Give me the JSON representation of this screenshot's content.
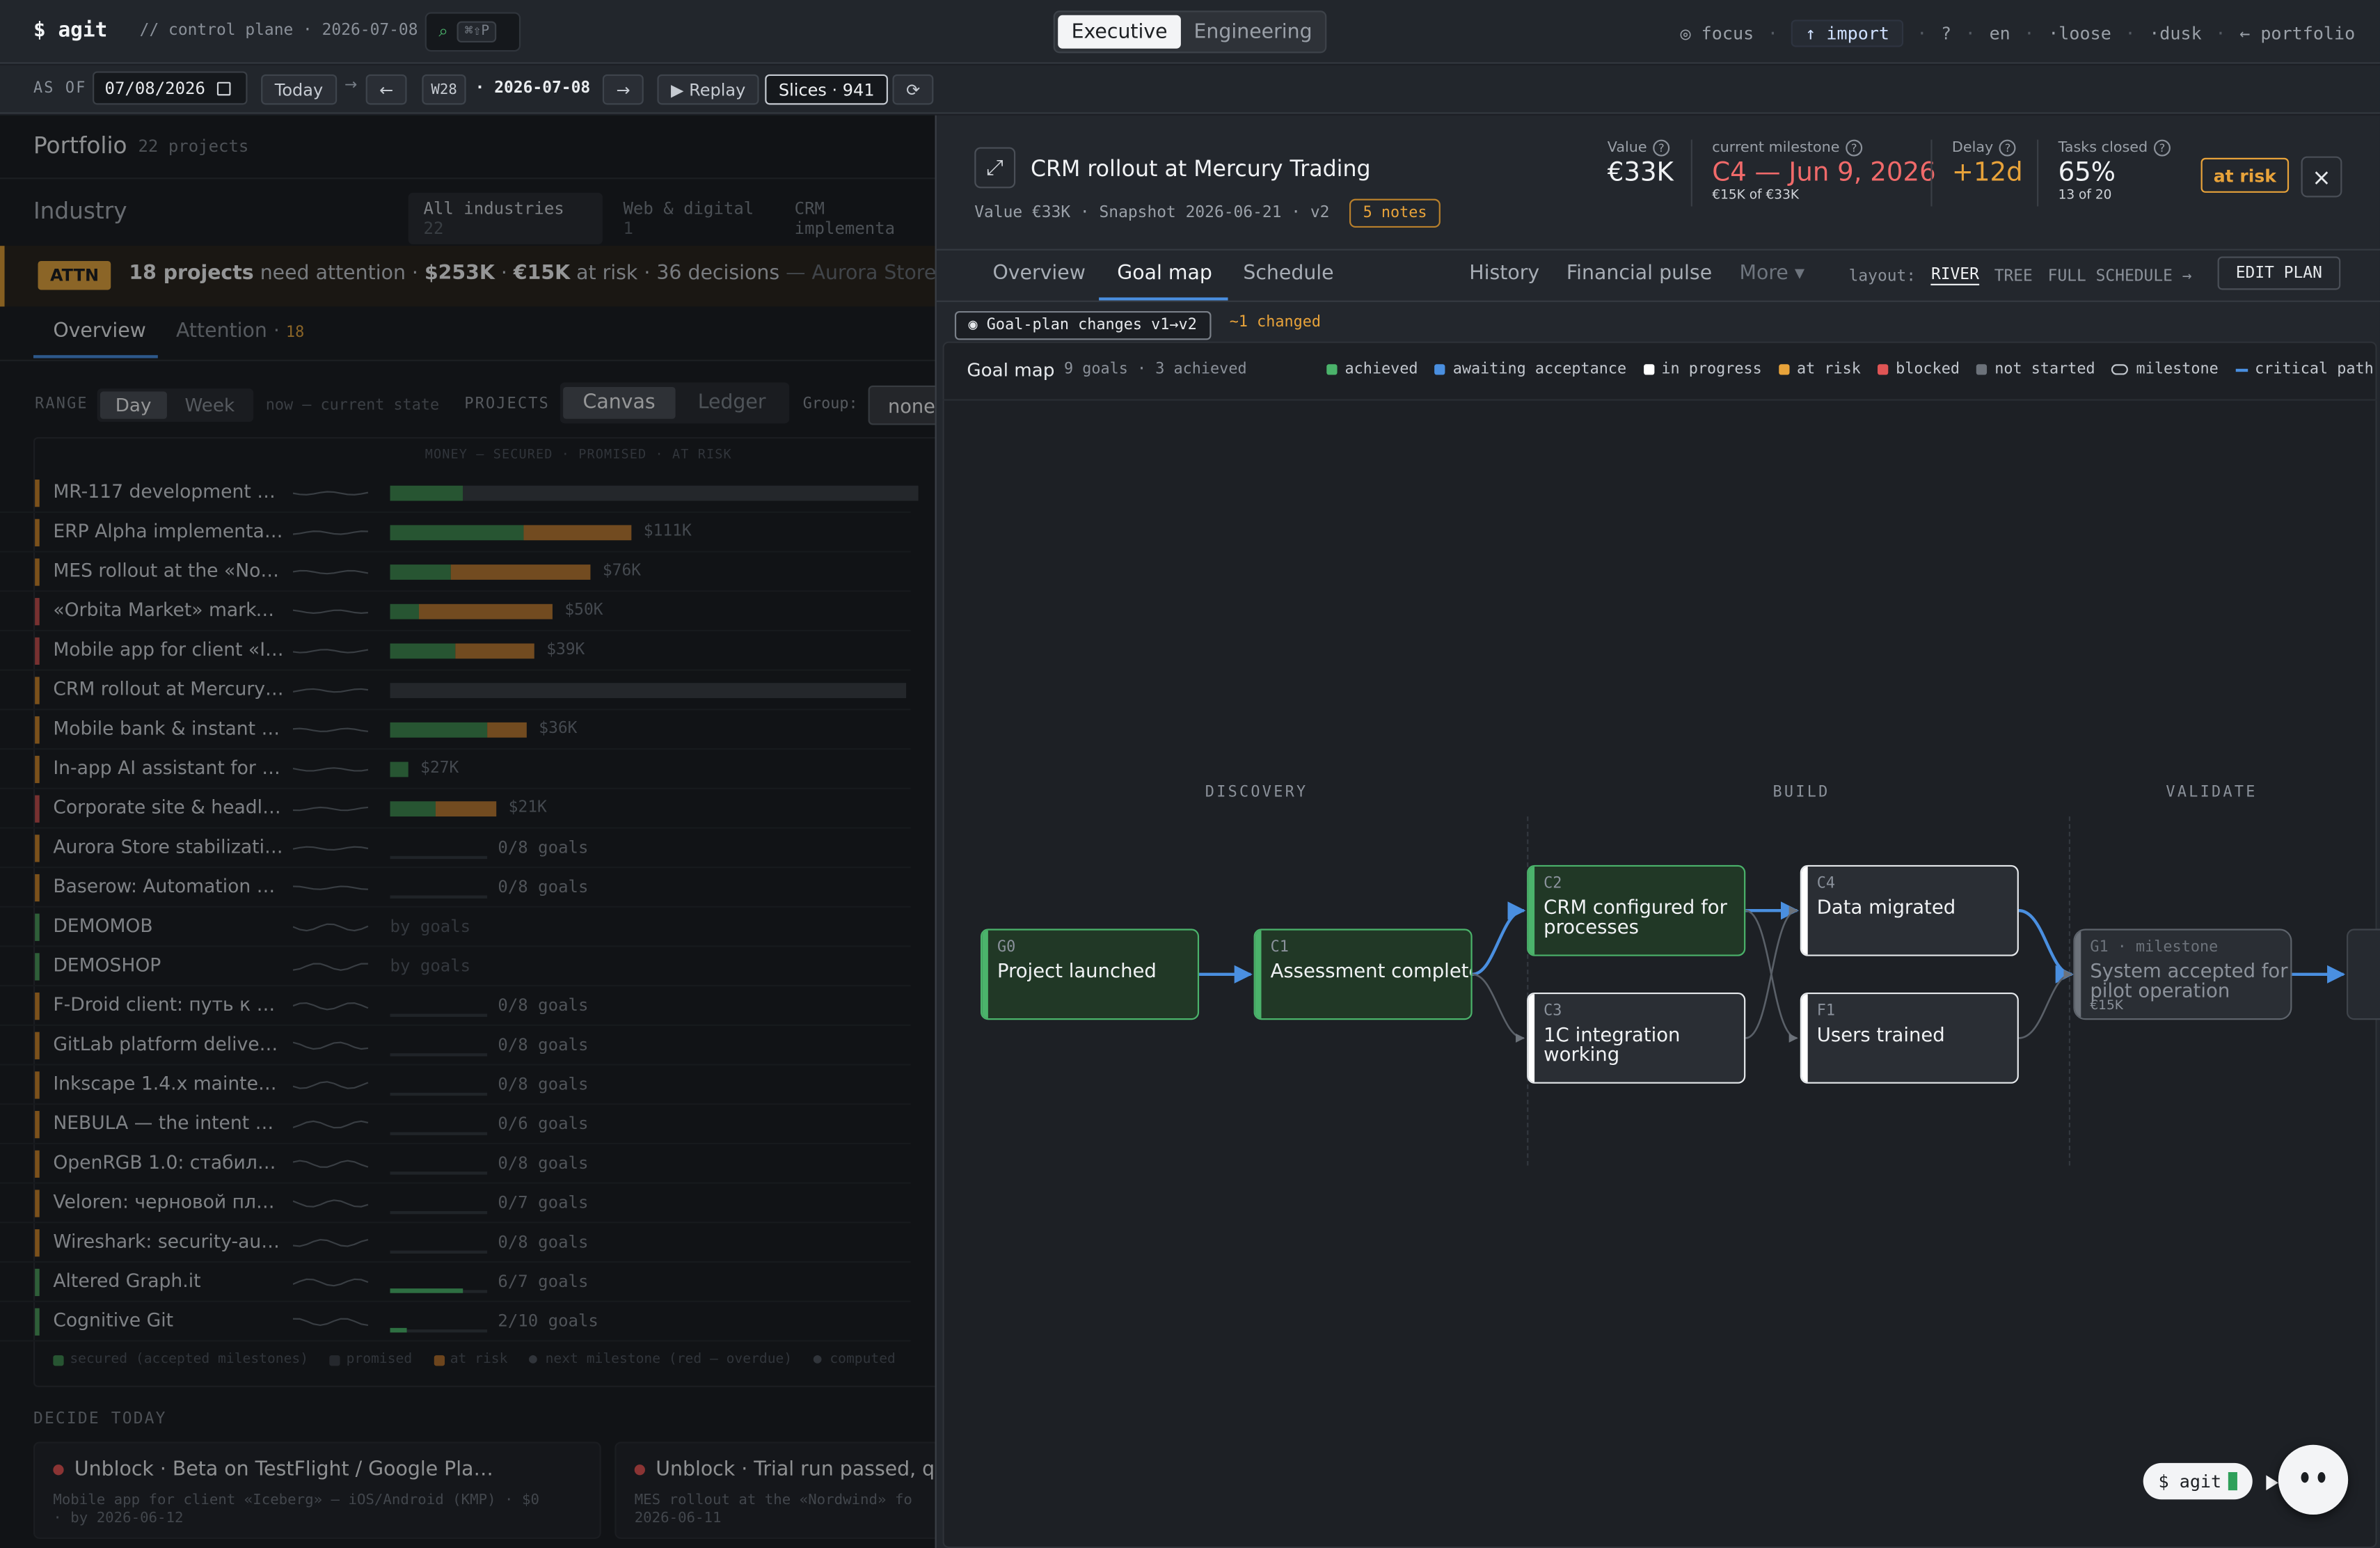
{
  "app": {
    "logo": "$ agit",
    "comment": "// control plane · 2026-07-08",
    "search_glyph": "⌕",
    "search_shortcut": "⌘⇧P",
    "modes": [
      "Executive",
      "Engineering"
    ],
    "active_mode": "Executive",
    "nav": {
      "focus": "◎ focus",
      "import": "↑ import",
      "help": "?",
      "lang": "en",
      "density": "·loose",
      "theme": "·dusk",
      "portfolio": "← portfolio"
    }
  },
  "datebar": {
    "as_of": "AS OF",
    "date": "07/08/2026",
    "today": "Today",
    "arrow": "→",
    "prev": "←",
    "week": "W28",
    "current": "· 2026-07-08",
    "next": "→",
    "replay": "▶ Replay",
    "slices": "Slices · 941",
    "refresh": "⟳"
  },
  "portfolio": {
    "title": "Portfolio",
    "count": "22 projects",
    "industry_label": "Industry",
    "industries": [
      {
        "label": "All industries",
        "count": "22"
      },
      {
        "label": "Web & digital",
        "count": "1"
      },
      {
        "label": "CRM implementa",
        "count": ""
      }
    ],
    "attn": {
      "badge": "ATTN",
      "strong": "18 projects",
      "text1": " need attention · ",
      "amount": "$253K",
      "text2": " · ",
      "risk": "€15K",
      "text3": " at risk · 36 decisions",
      "tail": " — Aurora Store stal"
    },
    "tabs": [
      {
        "label": "Overview"
      },
      {
        "label": "Attention",
        "count": "18"
      }
    ],
    "controls": {
      "range": "RANGE",
      "range_opts": [
        "Day",
        "Week"
      ],
      "now": "now — current state",
      "projects": "PROJECTS",
      "view_opts": [
        "Canvas",
        "Ledger"
      ],
      "group": "Group:",
      "group_val": "none"
    },
    "col_header": "MONEY — SECURED · PROMISED · AT RISK",
    "rows": [
      {
        "name": "MR-117 development —…",
        "color": "#c9842c",
        "secured": 48,
        "promised": 0,
        "risk": 0,
        "rest": 300,
        "amount": "",
        "goals": ""
      },
      {
        "name": "ERP Alpha implementati…",
        "color": "#c9842c",
        "secured": 88,
        "promised": 0,
        "risk": 71,
        "rest": 0,
        "amount": "$111K",
        "goals": ""
      },
      {
        "name": "MES rollout at the «Nor…",
        "color": "#c9842c",
        "secured": 40,
        "promised": 0,
        "risk": 92,
        "rest": 0,
        "amount": "$76K",
        "goals": ""
      },
      {
        "name": "«Orbita Market» market…",
        "color": "#c25050",
        "secured": 19,
        "promised": 0,
        "risk": 88,
        "rest": 0,
        "amount": "$50K",
        "goals": ""
      },
      {
        "name": "Mobile app for client «Ic…",
        "color": "#c25050",
        "secured": 43,
        "promised": 0,
        "risk": 52,
        "rest": 0,
        "amount": "$39K",
        "goals": ""
      },
      {
        "name": "CRM rollout at Mercury …",
        "color": "#c9842c",
        "secured": 0,
        "promised": 0,
        "risk": 0,
        "rest": 340,
        "amount": "",
        "goals": ""
      },
      {
        "name": "Mobile bank & instant p…",
        "color": "#c9842c",
        "secured": 64,
        "promised": 0,
        "risk": 26,
        "rest": 0,
        "amount": "$36K",
        "goals": ""
      },
      {
        "name": "In-app AI assistant for «…",
        "color": "#c9842c",
        "secured": 12,
        "promised": 66,
        "risk": 0,
        "rest": 0,
        "amount": "$27K",
        "goals": ""
      },
      {
        "name": "Corporate site & headle…",
        "color": "#c25050",
        "secured": 30,
        "promised": 0,
        "risk": 40,
        "rest": 0,
        "amount": "$21K",
        "goals": ""
      },
      {
        "name": "Aurora Store stabilizatio…",
        "color": "#c9842c",
        "goals": "0/8 goals"
      },
      {
        "name": "Baserow: Automation v…",
        "color": "#c9842c",
        "goals": "0/8 goals"
      },
      {
        "name": "DEMOMOB",
        "color": "#4c9a5c",
        "goals": "by goals"
      },
      {
        "name": "DEMOSHOP",
        "color": "#4c9a5c",
        "goals": "by goals"
      },
      {
        "name": "F-Droid client: путь к 2.0",
        "color": "#c9842c",
        "goals": "0/8 goals"
      },
      {
        "name": "GitLab platform delivery…",
        "color": "#c9842c",
        "goals": "0/8 goals"
      },
      {
        "name": "Inkscape 1.4.x mainten…",
        "color": "#c9842c",
        "goals": "0/8 goals"
      },
      {
        "name": "NEBULA — the intent be…",
        "color": "#c9842c",
        "goals": "0/6 goals"
      },
      {
        "name": "OpenRGB 1.0: стабили…",
        "color": "#c9842c",
        "goals": "0/8 goals"
      },
      {
        "name": "Veloren: черновой пла…",
        "color": "#c9842c",
        "goals": "0/7 goals"
      },
      {
        "name": "Wireshark: security-audi…",
        "color": "#c9842c",
        "goals": "0/8 goals"
      },
      {
        "name": "Altered Graph.it",
        "color": "#4c9a5c",
        "goals": "6/7 goals",
        "fill": 0.86
      },
      {
        "name": "Cognitive Git",
        "color": "#4c9a5c",
        "goals": "2/10 goals",
        "fill": 0.2
      }
    ],
    "legend": {
      "secured": "secured (accepted milestones)",
      "promised": "promised",
      "risk": "at risk",
      "next": "● next milestone (red — overdue)",
      "computed": "● computed"
    },
    "decide": {
      "title": "DECIDE TODAY",
      "cards": [
        {
          "title": "Unblock · Beta on TestFlight / Google Pla…",
          "sub1": "Mobile app for client «Iceberg» — iOS/Android (KMP) · $0",
          "sub2": "· by 2026-06-12"
        },
        {
          "title": "Unblock · Trial run passed, qu",
          "sub1": "MES rollout at the «Nordwind» fo",
          "sub2": "2026-06-11"
        }
      ]
    }
  },
  "panel": {
    "expand_icon": "⤢",
    "title": "CRM rollout at Mercury Trading",
    "meta": "Value €33K · Snapshot 2026-06-21 · v2",
    "notes": "5 notes",
    "kpis": [
      {
        "label": "Value",
        "value": "€33K",
        "sub": ""
      },
      {
        "label": "current milestone",
        "value": "C4 — Jun 9, 2026",
        "sub": "€15K of €33K"
      },
      {
        "label": "Delay",
        "value": "+12d",
        "sub": ""
      },
      {
        "label": "Tasks closed",
        "value": "65%",
        "sub": "13 of 20"
      }
    ],
    "status": "at risk",
    "close": "×",
    "tabs": [
      "Overview",
      "Goal map",
      "Schedule",
      "History",
      "Financial pulse"
    ],
    "active_tab": "Goal map",
    "more": "More ▾",
    "layout_label": "layout:",
    "layouts": [
      "RIVER",
      "TREE"
    ],
    "full_schedule": "FULL SCHEDULE →",
    "edit_plan": "EDIT PLAN",
    "changes": "◉ Goal-plan changes v1→v2",
    "changed": "~1 changed",
    "map": {
      "title": "Goal map",
      "count": "9 goals · 3 achieved",
      "legend": [
        {
          "label": "achieved",
          "color": "#4bb36b"
        },
        {
          "label": "awaiting acceptance",
          "color": "#4a8fe0"
        },
        {
          "label": "in progress",
          "color": "#ffffff"
        },
        {
          "label": "at risk",
          "color": "#e8a33a"
        },
        {
          "label": "blocked",
          "color": "#e05555"
        },
        {
          "label": "not started",
          "color": "#6c727a"
        },
        {
          "label": "milestone",
          "color": ""
        },
        {
          "label": "critical path",
          "color": "#4a8fe0"
        }
      ],
      "lanes": [
        "DISCOVERY",
        "BUILD",
        "VALIDATE"
      ],
      "nodes": [
        {
          "id": "G0",
          "title": "Project launched",
          "state": "achieved"
        },
        {
          "id": "C1",
          "title": "Assessment completed",
          "state": "achieved"
        },
        {
          "id": "C2",
          "title": "CRM configured for processes",
          "state": "achieved"
        },
        {
          "id": "C3",
          "title": "1C integration working",
          "state": "progress"
        },
        {
          "id": "C4",
          "title": "Data migrated",
          "state": "progress"
        },
        {
          "id": "F1",
          "title": "Users trained",
          "state": "progress"
        },
        {
          "id": "G1 · milestone",
          "title": "System accepted for pilot operation",
          "sub": "€15K",
          "state": "notstarted"
        }
      ]
    },
    "agent": {
      "label": "$ agit"
    }
  }
}
